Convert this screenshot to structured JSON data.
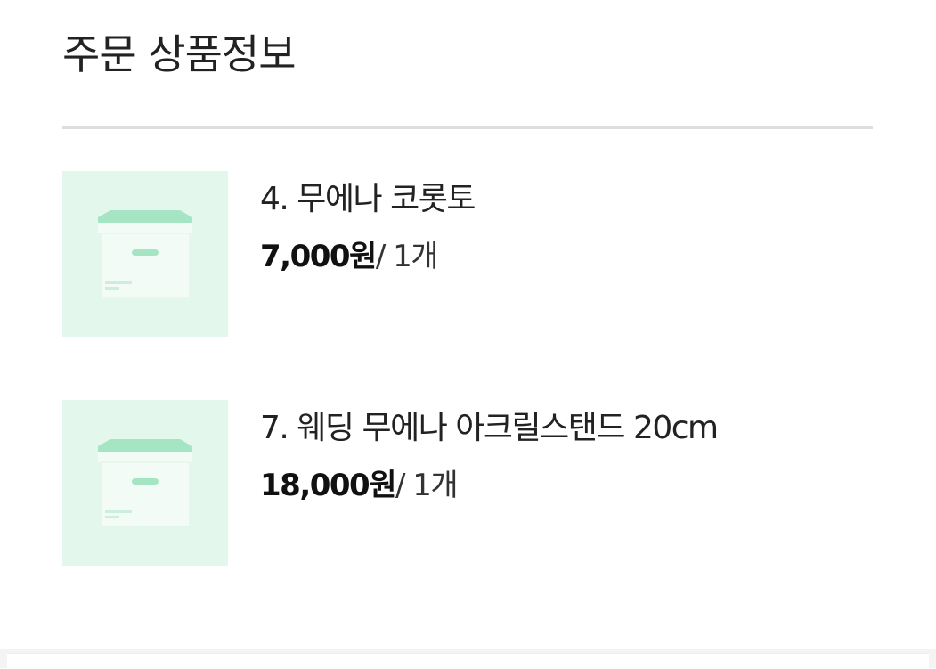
{
  "section": {
    "title": "주문 상품정보"
  },
  "products": [
    {
      "name": "4. 무에나 코롯토",
      "price": "7,000원",
      "quantity": "/ 1개",
      "thumbnail_icon": "box-placeholder-icon"
    },
    {
      "name": "7. 웨딩 무에나 아크릴스탠드 20cm",
      "price": "18,000원",
      "quantity": "/ 1개",
      "thumbnail_icon": "box-placeholder-icon"
    }
  ],
  "colors": {
    "thumbnail_background": "#e3f7ec",
    "box_lid": "#9fe3c0",
    "divider": "#dddddd",
    "text": "#222222"
  }
}
